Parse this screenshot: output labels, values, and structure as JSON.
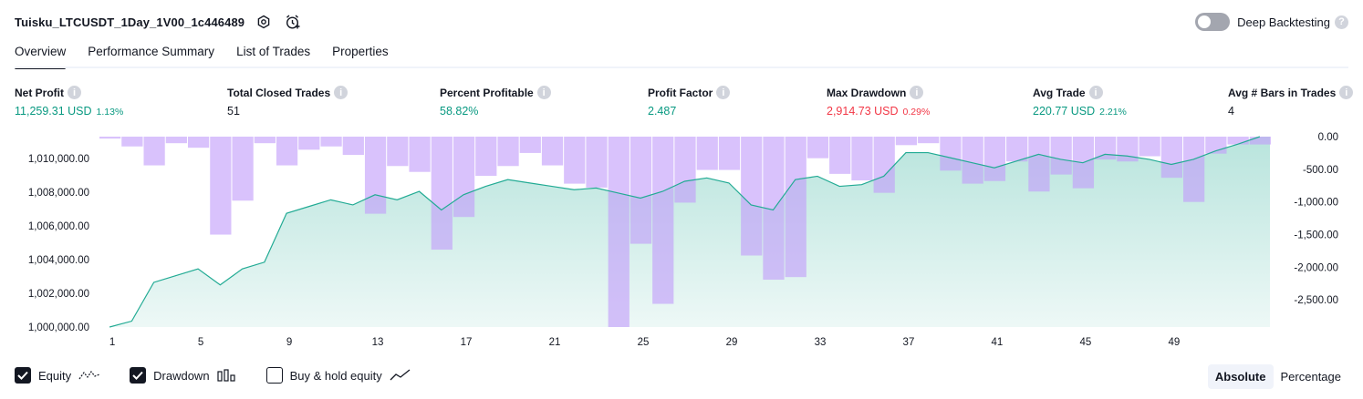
{
  "header": {
    "title": "Tuisku_LTCUSDT_1Day_1V00_1c446489",
    "deep_backtesting_label": "Deep Backtesting",
    "deep_backtesting_enabled": false
  },
  "tabs": [
    {
      "label": "Overview",
      "active": true
    },
    {
      "label": "Performance Summary",
      "active": false
    },
    {
      "label": "List of Trades",
      "active": false
    },
    {
      "label": "Properties",
      "active": false
    }
  ],
  "metrics": [
    {
      "label": "Net Profit",
      "value": "11,259.31 USD",
      "pct": "1.13%",
      "tone": "pos"
    },
    {
      "label": "Total Closed Trades",
      "value": "51",
      "pct": "",
      "tone": "neu"
    },
    {
      "label": "Percent Profitable",
      "value": "58.82%",
      "pct": "",
      "tone": "pos"
    },
    {
      "label": "Profit Factor",
      "value": "2.487",
      "pct": "",
      "tone": "pos"
    },
    {
      "label": "Max Drawdown",
      "value": "2,914.73 USD",
      "pct": "0.29%",
      "tone": "neg"
    },
    {
      "label": "Avg Trade",
      "value": "220.77 USD",
      "pct": "2.21%",
      "tone": "pos"
    },
    {
      "label": "Avg # Bars in Trades",
      "value": "4",
      "pct": "",
      "tone": "neu"
    }
  ],
  "legend": {
    "equity_label": "Equity",
    "equity_checked": true,
    "drawdown_label": "Drawdown",
    "drawdown_checked": true,
    "buyhold_label": "Buy & hold equity",
    "buyhold_checked": false
  },
  "modes": {
    "absolute_label": "Absolute",
    "percentage_label": "Percentage",
    "active": "Absolute"
  },
  "colors": {
    "equity_line": "#22ab94",
    "equity_fill": "#22ab94",
    "drawdown": "#c29cfa",
    "positive": "#089981",
    "negative": "#f23645"
  },
  "chart_data": {
    "type": "area",
    "x_ticks": [
      1,
      5,
      9,
      13,
      17,
      21,
      25,
      29,
      33,
      37,
      41,
      45,
      49
    ],
    "left_axis": {
      "ticks": [
        "1,000,000.00",
        "1,002,000.00",
        "1,004,000.00",
        "1,006,000.00",
        "1,008,000.00",
        "1,010,000.00"
      ],
      "ylim": [
        1000000,
        1011300
      ]
    },
    "right_axis": {
      "ticks": [
        "0.00",
        "-500.00",
        "-1,000.00",
        "-1,500.00",
        "-2,000.00",
        "-2,500.00"
      ],
      "ylim": [
        -2915,
        0
      ]
    },
    "series": [
      {
        "name": "Equity",
        "kind": "area",
        "values": [
          1000000,
          1000350,
          1002650,
          1003050,
          1003450,
          1002500,
          1003450,
          1003850,
          1006750,
          1007150,
          1007550,
          1007250,
          1007850,
          1007550,
          1008050,
          1006950,
          1007850,
          1008350,
          1008750,
          1008550,
          1008350,
          1008150,
          1008250,
          1007950,
          1007650,
          1008050,
          1008650,
          1008850,
          1008550,
          1007250,
          1006950,
          1008750,
          1008950,
          1008350,
          1008450,
          1008950,
          1010350,
          1010350,
          1010050,
          1009750,
          1009450,
          1009850,
          1010250,
          1009950,
          1009750,
          1010250,
          1010150,
          1009950,
          1009650,
          1009950,
          1010450,
          1010850,
          1011300
        ]
      },
      {
        "name": "Drawdown",
        "kind": "bar",
        "values": [
          -30,
          -150,
          -440,
          -100,
          -170,
          -1500,
          -980,
          -100,
          -440,
          -200,
          -150,
          -280,
          -1180,
          -450,
          -540,
          -1730,
          -1230,
          -600,
          -450,
          -250,
          -440,
          -720,
          -780,
          -2915,
          -1640,
          -2560,
          -1010,
          -510,
          -510,
          -1820,
          -2190,
          -2150,
          -330,
          -570,
          -670,
          -860,
          -130,
          -100,
          -520,
          -720,
          -680,
          -380,
          -840,
          -580,
          -790,
          -350,
          -380,
          -300,
          -630,
          -1000,
          -260,
          -120,
          -120
        ]
      }
    ]
  }
}
